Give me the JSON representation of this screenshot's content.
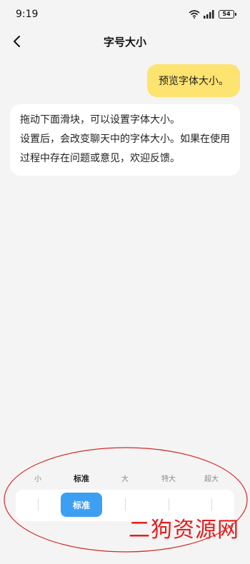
{
  "status_bar": {
    "time": "9:19",
    "battery": "54"
  },
  "nav": {
    "title": "字号大小"
  },
  "chat": {
    "preview_message": "预览字体大小。",
    "info_lines": [
      "拖动下面滑块，可以设置字体大小。",
      "设置后，会改变聊天中的字体大小。如果在使用",
      "过程中存在问题或意见，欢迎反馈。"
    ]
  },
  "font_size": {
    "options": [
      "小",
      "标准",
      "大",
      "特大",
      "超大"
    ],
    "selected_index": 1,
    "selected_label": "标准"
  },
  "watermark": "二狗资源网",
  "colors": {
    "background": "#f4f4f4",
    "bubble_self": "#fde36f",
    "bubble_other": "#ffffff",
    "slider_thumb": "#3d9ff2",
    "annotation": "#d62828"
  }
}
